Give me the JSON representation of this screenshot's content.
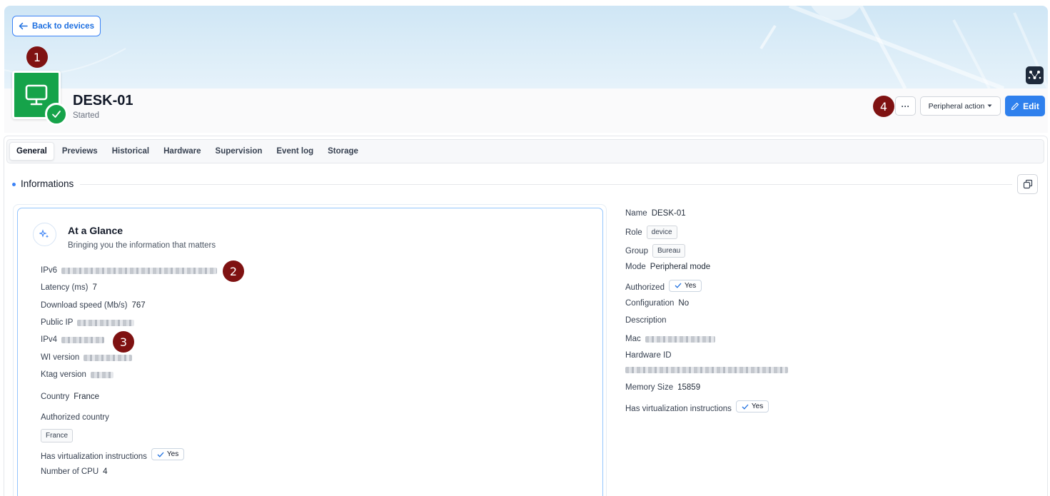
{
  "nav": {
    "back_label": "Back to devices"
  },
  "device": {
    "name": "DESK-01",
    "status": "Started"
  },
  "markers": [
    "1",
    "2",
    "3",
    "4"
  ],
  "actions": {
    "more_label": "···",
    "peripheral_label": "Peripheral action",
    "edit_label": "Edit"
  },
  "tabs": [
    "General",
    "Previews",
    "Historical",
    "Hardware",
    "Supervision",
    "Event log",
    "Storage"
  ],
  "section": {
    "title": "Informations"
  },
  "glance": {
    "title": "At a Glance",
    "subtitle": "Bringing you the information that matters",
    "ipv6_label": "IPv6",
    "latency_label": "Latency (ms)",
    "latency_value": "7",
    "download_label": "Download speed (Mb/s)",
    "download_value": "767",
    "public_ip_label": "Public IP",
    "ipv4_label": "IPv4",
    "wi_version_label": "WI version",
    "ktag_version_label": "Ktag version",
    "country_label": "Country",
    "country_value": "France",
    "authorized_country_label": "Authorized country",
    "authorized_country_value": "France",
    "virtualization_label": "Has virtualization instructions",
    "virtualization_value": "Yes",
    "cpu_label": "Number of CPU",
    "cpu_value": "4"
  },
  "details": {
    "name_label": "Name",
    "name_value": "DESK-01",
    "role_label": "Role",
    "role_value": "device",
    "group_label": "Group",
    "group_value": "Bureau",
    "mode_label": "Mode",
    "mode_value": "Peripheral mode",
    "authorized_label": "Authorized",
    "authorized_value": "Yes",
    "configuration_label": "Configuration",
    "configuration_value": "No",
    "description_label": "Description",
    "mac_label": "Mac",
    "hardware_id_label": "Hardware ID",
    "memory_label": "Memory Size",
    "memory_value": "15859",
    "virtualization_label": "Has virtualization instructions",
    "virtualization_value": "Yes"
  },
  "colors": {
    "accent": "#2f80ed",
    "success": "#16a34a",
    "marker": "#7f1212"
  }
}
